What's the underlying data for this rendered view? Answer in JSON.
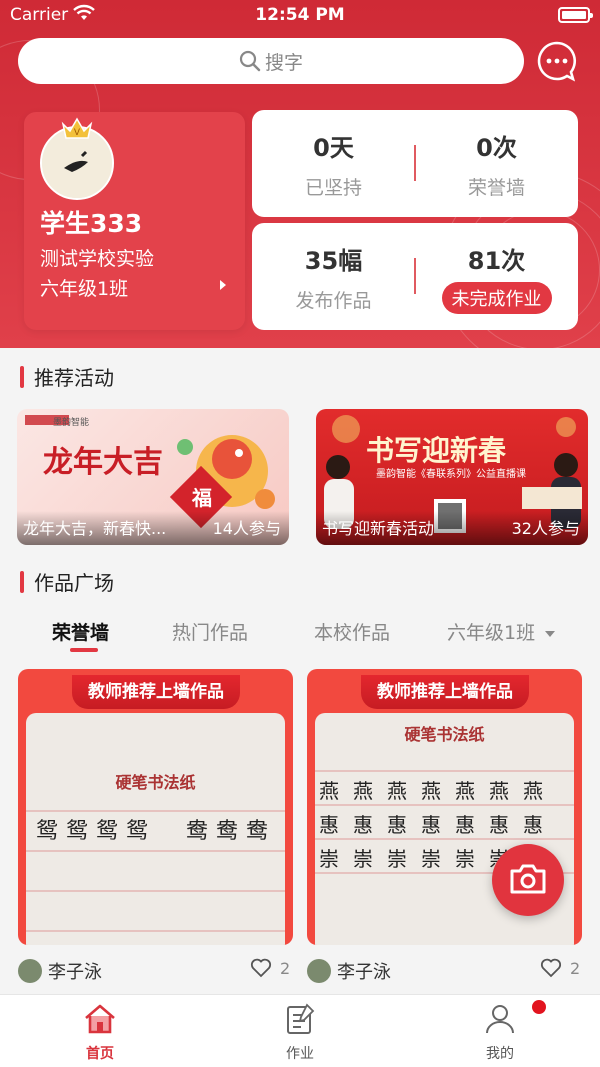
{
  "status_bar": {
    "carrier": "Carrier",
    "time": "12:54 PM"
  },
  "search": {
    "placeholder": "搜字"
  },
  "profile": {
    "name": "学生333",
    "school": "测试学校实验",
    "class_name": "六年级1班"
  },
  "stats": {
    "days": {
      "value": "0天",
      "label": "已坚持"
    },
    "honor": {
      "value": "0次",
      "label": "荣誉墙"
    },
    "works": {
      "value": "35幅",
      "label": "发布作品"
    },
    "homework": {
      "value": "81次",
      "label": "未完成作业"
    }
  },
  "sections": {
    "activities_title": "推荐活动",
    "gallery_title": "作品广场"
  },
  "activities": [
    {
      "title": "龙年大吉，新春快...",
      "count": "14人参与",
      "poster_text": "龙年大吉",
      "poster_sub": "墨韵智能",
      "fu": "福"
    },
    {
      "title": "书写迎新春活动",
      "count": "32人参与",
      "poster_text": "书写迎新春",
      "poster_sub": "墨韵智能《春联系列》公益直播课"
    }
  ],
  "gallery_tabs": [
    {
      "label": "荣誉墙",
      "active": true
    },
    {
      "label": "热门作品",
      "active": false
    },
    {
      "label": "本校作品",
      "active": false
    },
    {
      "label": "六年级1班",
      "active": false
    }
  ],
  "works": [
    {
      "banner": "教师推荐上墙作品",
      "paper_title": "硬笔书法纸",
      "author": "李子泳",
      "likes": "2",
      "chars": [
        "鸳",
        "鸳",
        "鸳",
        "鸳",
        "",
        "鸯",
        "鸯",
        "鸯"
      ]
    },
    {
      "banner": "教师推荐上墙作品",
      "paper_title": "硬笔书法纸",
      "author": "李子泳",
      "likes": "2",
      "chars": [
        "燕",
        "燕",
        "燕",
        "燕",
        "燕",
        "燕",
        "燕",
        "惠",
        "惠",
        "惠",
        "惠",
        "惠",
        "惠",
        "惠",
        "崇",
        "崇",
        "崇",
        "崇",
        "崇",
        "崇",
        "崇"
      ]
    }
  ],
  "tabbar": [
    {
      "label": "首页",
      "active": true
    },
    {
      "label": "作业",
      "active": false
    },
    {
      "label": "我的",
      "active": false
    }
  ],
  "colors": {
    "brand_red": "#e23842",
    "hero_red": "#cf2a36"
  }
}
